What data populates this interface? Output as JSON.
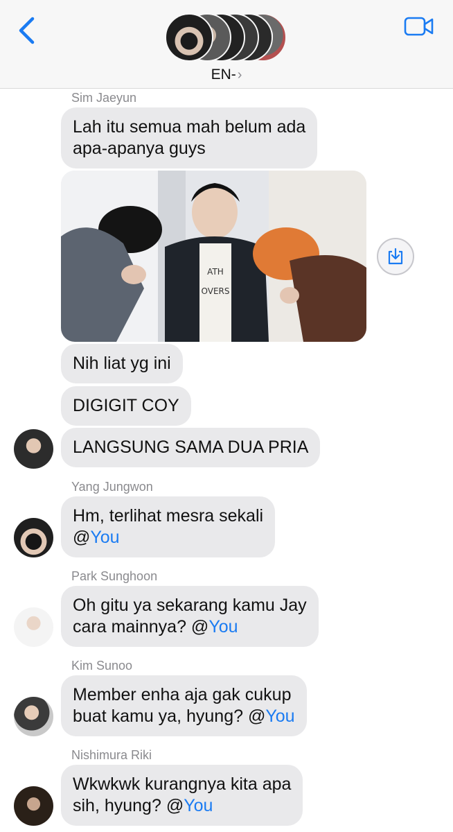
{
  "header": {
    "group_name": "EN-",
    "chevron": "›",
    "icons": {
      "back": "chevron-left-icon",
      "video": "video-camera-icon"
    },
    "accent": "#1a7bf2"
  },
  "messages": {
    "m1": {
      "sender": "Sim Jaeyun",
      "text": "Lah itu semua mah belum ada apa-apanya guys",
      "line1": "Lah itu semua mah belum ada",
      "line2": "apa-apanya guys"
    },
    "m2": {
      "text": "Nih liat yg ini"
    },
    "m3": {
      "text": "DIGIGIT COY"
    },
    "m4": {
      "text": "LANGSUNG SAMA DUA PRIA"
    },
    "m5": {
      "sender": "Yang Jungwon",
      "line1": "Hm, terlihat mesra sekali",
      "line2_prefix": "@",
      "mention": "You"
    },
    "m6": {
      "sender": "Park Sunghoon",
      "line1": "Oh gitu ya sekarang kamu Jay",
      "line2_prefix": "cara mainnya? @",
      "mention": "You"
    },
    "m7": {
      "sender": "Kim Sunoo",
      "line1": "Member enha aja gak cukup",
      "line2_prefix": "buat kamu ya, hyung? @",
      "mention": "You"
    },
    "m8": {
      "sender": "Nishimura Riki",
      "line1": "Wkwkwk kurangnya kita apa",
      "line2_prefix": "sih, hyung? @",
      "mention": "You"
    }
  },
  "colors": {
    "bubble": "#e9e9eb",
    "mention": "#1a7bf2",
    "sender_label": "#8a8a8e"
  }
}
